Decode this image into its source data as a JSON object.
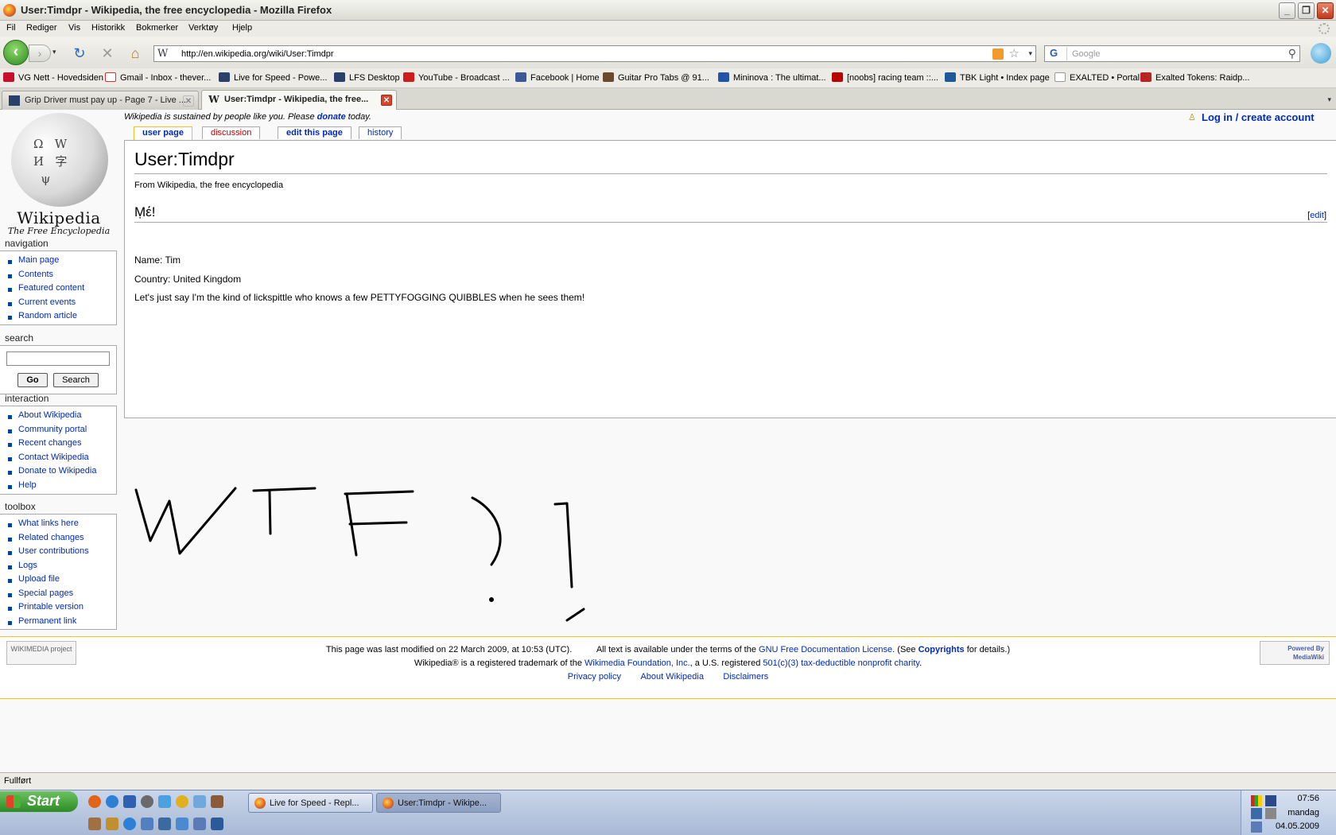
{
  "window": {
    "title": "User:Timdpr - Wikipedia, the free encyclopedia - Mozilla Firefox",
    "controls": [
      "_",
      "❐",
      "✕"
    ]
  },
  "menu": [
    "Fil",
    "Rediger",
    "Vis",
    "Historikk",
    "Bokmerker",
    "Verktøy",
    "Hjelp"
  ],
  "navbar": {
    "back": "‹",
    "forward": "›",
    "reload": "↻",
    "stop": "✕",
    "home": "⌂",
    "favicon": "W",
    "url": "http://en.wikipedia.org/wiki/User:Timdpr",
    "star": "☆",
    "dropdown": "▾",
    "search_engine": "G",
    "search_placeholder": "Google",
    "search_icon": "⚲"
  },
  "bookmarks": [
    "VG Nett - Hovedsiden",
    "Gmail - Inbox - thever...",
    "Live for Speed - Powe...",
    "LFS Desktop",
    "YouTube - Broadcast ...",
    "Facebook | Home",
    "Guitar Pro Tabs @ 91...",
    "Mininova : The ultimat...",
    "[noobs] racing team ::...",
    "TBK Light • Index page",
    "EXALTED • Portal",
    "Exalted Tokens: Raidp..."
  ],
  "tabs": [
    {
      "label": "Grip Driver must pay up - Page 7 - Live ..."
    },
    {
      "label": "User:Timdpr - Wikipedia, the free..."
    }
  ],
  "wiki": {
    "logo_text": "Wikipedia",
    "logo_sub": "The Free Encyclopedia",
    "sitenotice_before": "Wikipedia is sustained by people like you. Please ",
    "sitenotice_link": "donate",
    "sitenotice_after": " today.",
    "login": "Log in / create account",
    "content_tabs": [
      "user page",
      "discussion",
      "edit this page",
      "history"
    ],
    "heading": "User:Timdpr",
    "site_sub": "From Wikipedia, the free encyclopedia",
    "section_heading": "Ṃέ!",
    "edit_link": "edit",
    "lines": [
      "Name: Tim",
      "Country: United Kingdom",
      "Let's just say I'm the kind of lickspittle who knows a few PETTYFOGGING QUIBBLES when he sees them!"
    ],
    "navigation": {
      "heading": "navigation",
      "items": [
        "Main page",
        "Contents",
        "Featured content",
        "Current events",
        "Random article"
      ]
    },
    "search": {
      "heading": "search",
      "go": "Go",
      "search": "Search"
    },
    "interaction": {
      "heading": "interaction",
      "items": [
        "About Wikipedia",
        "Community portal",
        "Recent changes",
        "Contact Wikipedia",
        "Donate to Wikipedia",
        "Help"
      ]
    },
    "toolbox": {
      "heading": "toolbox",
      "items": [
        "What links here",
        "Related changes",
        "User contributions",
        "Logs",
        "Upload file",
        "Special pages",
        "Printable version",
        "Permanent link"
      ]
    },
    "footer": {
      "lastmod": "This page was last modified on 22 March 2009, at 10:53 (UTC).",
      "license_pre": "All text is available under the terms of the ",
      "license_link": "GNU Free Documentation License",
      "license_mid": ". (See ",
      "copyrights": "Copyrights",
      "license_post": " for details.)",
      "tm_pre": "Wikipedia® is a registered trademark of the ",
      "tm_link": "Wikimedia Foundation, Inc.",
      "tm_mid": ", a U.S. registered ",
      "tm_link2": "501(c)(3) tax-deductible nonprofit charity",
      "tm_post": ".",
      "links": [
        "Privacy policy",
        "About Wikipedia",
        "Disclaimers"
      ],
      "wikimedia_logo": "WIKIMEDIA project",
      "mediawiki_logo": "Powered By MediaWiki"
    }
  },
  "status": "Fullført",
  "taskbar": {
    "start": "Start",
    "windows": [
      "Live for Speed - Repl...",
      "User:Timdpr - Wikipe..."
    ],
    "time": "07:56",
    "day": "mandag",
    "date": "04.05.2009"
  }
}
